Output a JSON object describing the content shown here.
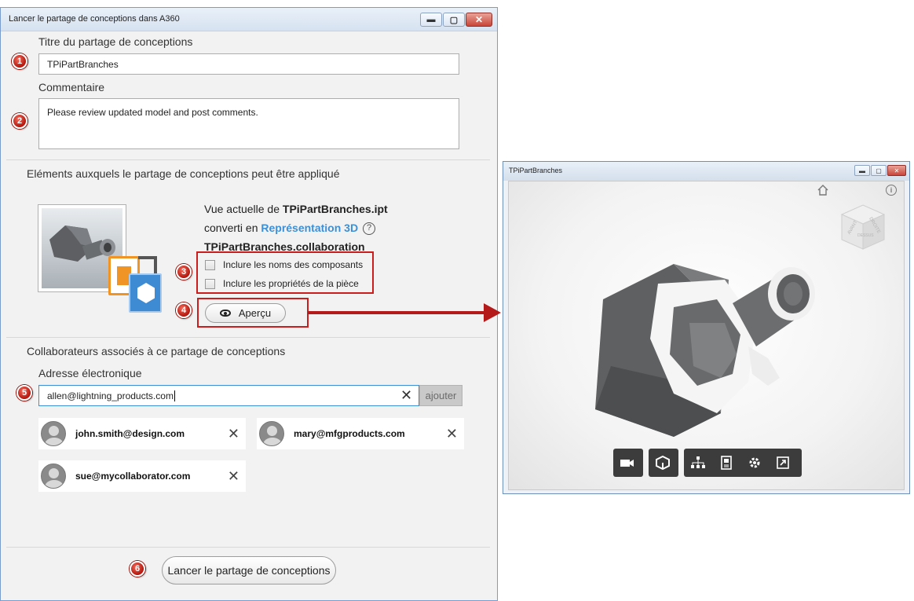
{
  "dialog": {
    "title": "Lancer le partage de conceptions dans A360",
    "window_buttons": {
      "minimize": "▬",
      "maximize": "▢",
      "close": "✕"
    },
    "design_title_label": "Titre du partage de conceptions",
    "design_title_value": "TPiPartBranches",
    "comment_label": "Commentaire",
    "comment_value": "Please review updated model and post comments.",
    "elements_heading": "Eléments auxquels le partage de conceptions peut être appliqué",
    "view": {
      "line1_prefix": "Vue actuelle de ",
      "file_name": "TPiPartBranches.ipt",
      "line2_prefix": "converti en ",
      "representation": "Représentation 3D",
      "help_glyph": "?",
      "collab_file": "TPiPartBranches.collaboration"
    },
    "options": [
      {
        "label": "Inclure les noms des composants",
        "checked": false
      },
      {
        "label": "Inclure les propriétés de la pièce",
        "checked": false
      }
    ],
    "preview_button": "Aperçu",
    "collaborators_heading": "Collaborateurs associés à ce partage de conceptions",
    "email_label": "Adresse électronique",
    "email_value": "allen@lightning_products.com",
    "add_button": "ajouter",
    "clear_glyph": "✕",
    "collaborators": [
      {
        "email": "john.smith@design.com"
      },
      {
        "email": "mary@mfgproducts.com"
      },
      {
        "email": "sue@mycollaborator.com"
      }
    ],
    "launch_button": "Lancer le partage de conceptions",
    "badges": [
      "1",
      "2",
      "3",
      "4",
      "5",
      "6"
    ]
  },
  "viewer": {
    "title": "TPiPartBranches",
    "window_buttons": {
      "minimize": "▬",
      "maximize": "▢",
      "close": "✕"
    },
    "info_glyph": "i",
    "viewcube_labels": [
      "AVANT",
      "DROITE",
      "DESSUS"
    ],
    "toolbar_icons": [
      "camera-icon",
      "cube-view-icon",
      "structure-icon",
      "properties-icon",
      "settings-icon",
      "fullscreen-icon"
    ]
  },
  "colors": {
    "badge_red": "#c62015",
    "annotation_red": "#cc1d1d",
    "link_blue": "#3d8fd6",
    "toolbar_dark": "#3c3c3c"
  }
}
